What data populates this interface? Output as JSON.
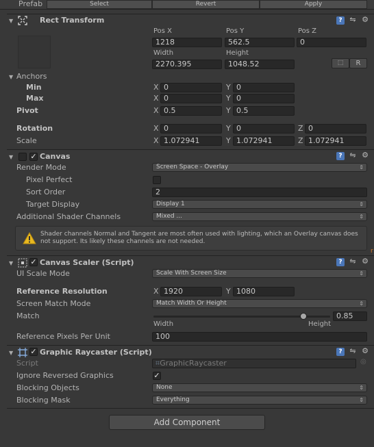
{
  "prefab": {
    "label": "Prefab",
    "select": "Select",
    "revert": "Revert",
    "apply": "Apply"
  },
  "rect_transform": {
    "title": "Rect Transform",
    "pos_x_label": "Pos X",
    "pos_y_label": "Pos Y",
    "pos_z_label": "Pos Z",
    "pos_x": "1218",
    "pos_y": "562.5",
    "pos_z": "0",
    "width_label": "Width",
    "height_label": "Height",
    "width": "2270.395",
    "height": "1048.52",
    "r_button": "R",
    "anchors_label": "Anchors",
    "min_label": "Min",
    "max_label": "Max",
    "min_x": "0",
    "min_y": "0",
    "max_x": "0",
    "max_y": "0",
    "pivot_label": "Pivot",
    "pivot_x": "0.5",
    "pivot_y": "0.5",
    "rotation_label": "Rotation",
    "rot_x": "0",
    "rot_y": "0",
    "rot_z": "0",
    "scale_label": "Scale",
    "scale_x": "1.072941",
    "scale_y": "1.072941",
    "scale_z": "1.072941",
    "x": "X",
    "y": "Y",
    "z": "Z"
  },
  "canvas": {
    "title": "Canvas",
    "render_mode_label": "Render Mode",
    "render_mode": "Screen Space - Overlay",
    "pixel_perfect_label": "Pixel Perfect",
    "sort_order_label": "Sort Order",
    "sort_order": "2",
    "target_display_label": "Target Display",
    "target_display": "Display 1",
    "shader_channels_label": "Additional Shader Channels",
    "shader_channels": "Mixed ...",
    "warning": "Shader channels Normal and Tangent are most often used with lighting, which an Overlay canvas does not support. Its likely these channels are not needed."
  },
  "canvas_scaler": {
    "title": "Canvas Scaler (Script)",
    "scale_mode_label": "UI Scale Mode",
    "scale_mode": "Scale With Screen Size",
    "ref_res_label": "Reference Resolution",
    "ref_x": "1920",
    "ref_y": "1080",
    "match_mode_label": "Screen Match Mode",
    "match_mode": "Match Width Or Height",
    "match_label": "Match",
    "match_value": "0.85",
    "width_label": "Width",
    "height_label": "Height",
    "ref_ppu_label": "Reference Pixels Per Unit",
    "ref_ppu": "100"
  },
  "raycaster": {
    "title": "Graphic Raycaster (Script)",
    "script_label": "Script",
    "script_value": "GraphicRaycaster",
    "ignore_reversed_label": "Ignore Reversed Graphics",
    "blocking_objects_label": "Blocking Objects",
    "blocking_objects": "None",
    "blocking_mask_label": "Blocking Mask",
    "blocking_mask": "Everything"
  },
  "add_component": "Add Component",
  "icons": [
    "help-icon",
    "preset-icon",
    "gear-icon",
    "warning-icon",
    "rect-transform-icon",
    "canvas-scaler-icon",
    "raycaster-icon",
    "script-icon"
  ]
}
